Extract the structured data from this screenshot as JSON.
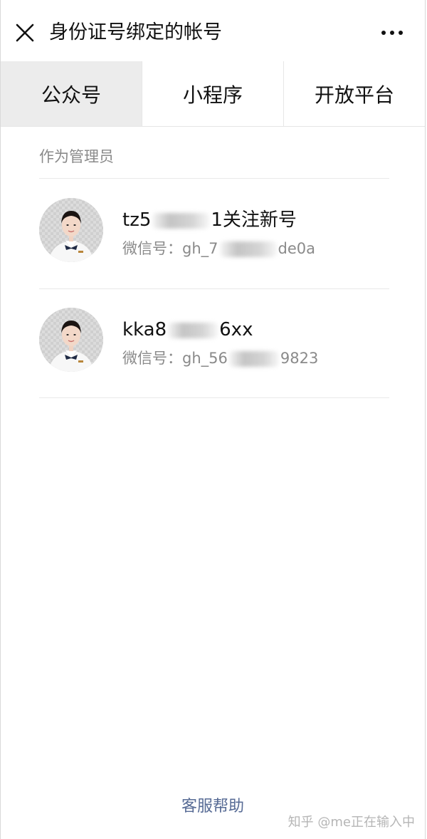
{
  "header": {
    "title": "身份证号绑定的帐号",
    "close_icon": "close-icon",
    "more_icon": "more-icon"
  },
  "tabs": [
    {
      "label": "公众号",
      "active": true
    },
    {
      "label": "小程序",
      "active": false
    },
    {
      "label": "开放平台",
      "active": false
    }
  ],
  "section": {
    "label": "作为管理员"
  },
  "accounts": [
    {
      "name_prefix": "tz5",
      "name_suffix": "1关注新号",
      "id_label": "微信号：",
      "id_prefix": "gh_7",
      "id_suffix": "de0a"
    },
    {
      "name_prefix": "kka8",
      "name_suffix": "6xx",
      "id_label": "微信号：",
      "id_prefix": "gh_56",
      "id_suffix": "9823"
    }
  ],
  "footer": {
    "help_label": "客服帮助",
    "watermark": "知乎 @me正在输入中"
  },
  "colors": {
    "link": "#576b95",
    "active_tab_bg": "#ececec",
    "secondary_text": "#8a8a8a"
  }
}
